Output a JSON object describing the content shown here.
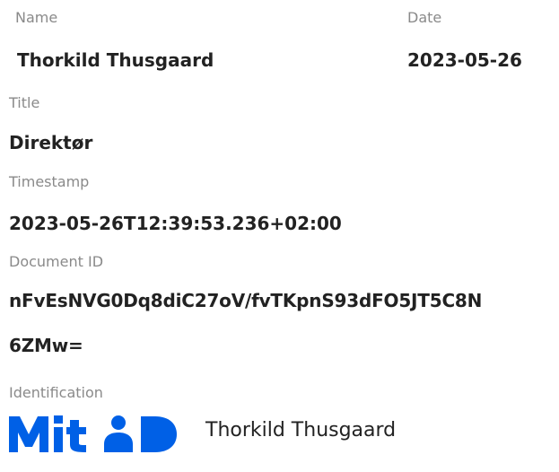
{
  "signature": {
    "name_label": "Name",
    "name_value": "Thorkild Thusgaard",
    "date_label": "Date",
    "date_value": "2023-05-26",
    "title_label": "Title",
    "title_value": "Direktør",
    "timestamp_label": "Timestamp",
    "timestamp_value": "2023-05-26T12:39:53.236+02:00",
    "docid_label": "Document ID",
    "docid_line1": "nFvEsNVG0Dq8diC27oV/fvTKpnS93dFO5JT5C8N",
    "docid_line2": "6ZMw=",
    "identification_label": "Identification",
    "identification_provider": "MitID",
    "identification_name": "Thorkild Thusgaard"
  },
  "colors": {
    "label": "#8a8a8a",
    "value": "#222222",
    "mitid_blue": "#0060e6"
  }
}
